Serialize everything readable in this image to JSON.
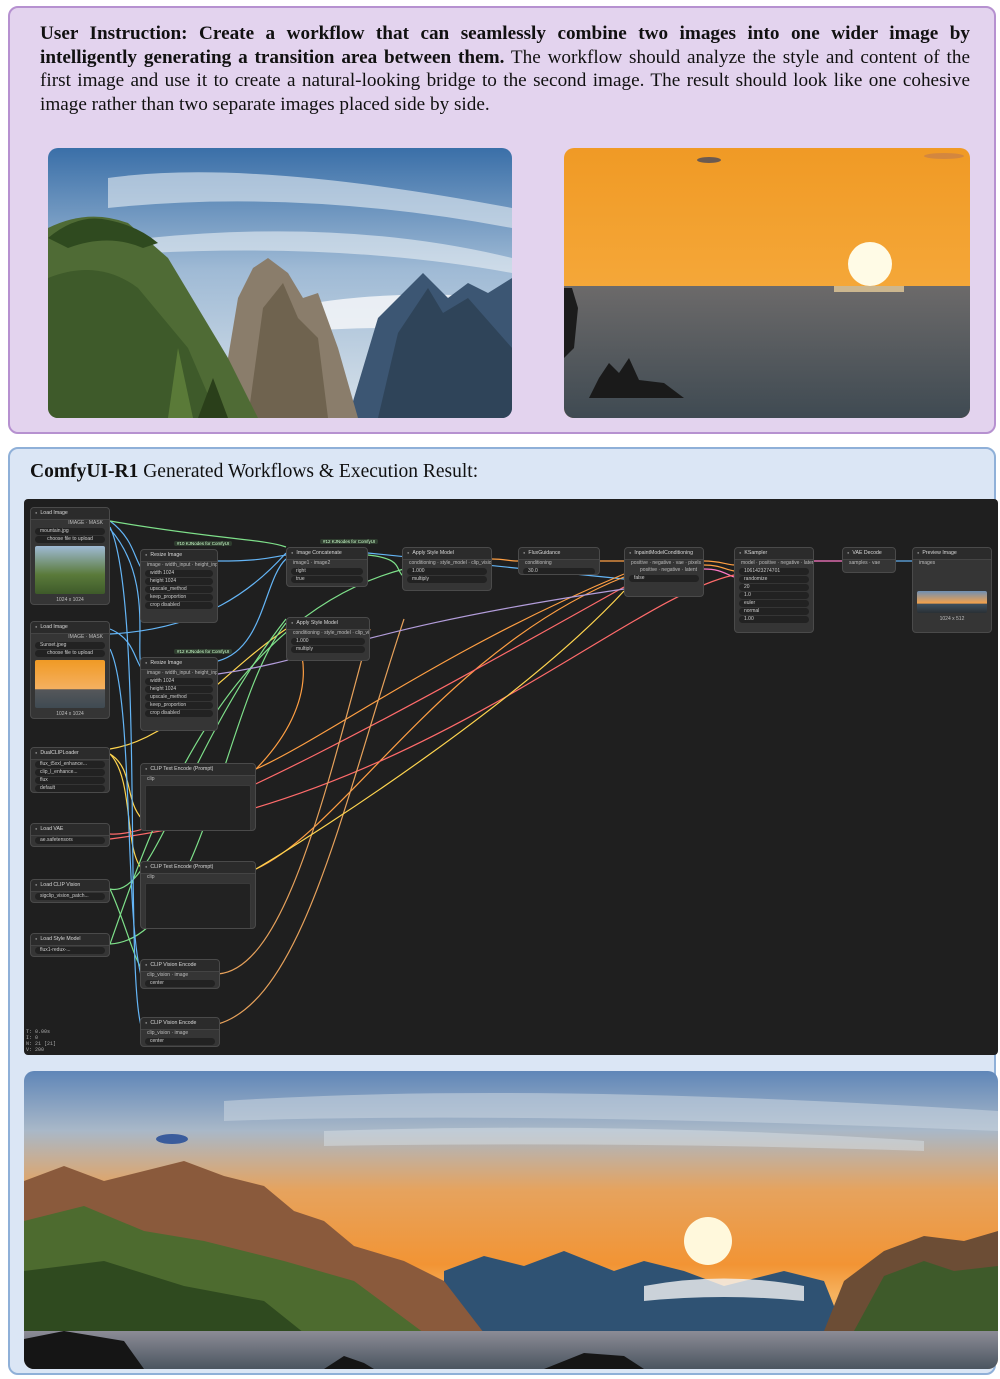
{
  "instruction": {
    "bold": "User Instruction: Create a workflow that can seamlessly combine two images into one wider image by intelligently generating a transition area between them.",
    "rest": " The workflow should analyze the style and content of the first image and use it to create a natural-looking bridge to the second image. The result should look like one cohesive image rather than two separate images placed side by side."
  },
  "result_title": {
    "bold": "ComfyUI-R1",
    "rest": " Generated Workflows & Execution Result:"
  },
  "nodes": {
    "load1": {
      "title": "Load Image",
      "id": "#1",
      "image": "mountain.jpg",
      "upload": "choose file to upload",
      "size": "1024 x 1024"
    },
    "load2": {
      "title": "Load Image",
      "id": "#2",
      "image": "Sunset.jpeg",
      "upload": "choose file to upload",
      "size": "1024 x 1024"
    },
    "resize1": {
      "title": "Resize Image",
      "badge": "#10 KJNodes for ComfyUI"
    },
    "resize2": {
      "title": "Resize Image",
      "badge": "#12 KJNodes for ComfyUI"
    },
    "dualclip": {
      "title": "DualCLIPLoader",
      "id": "#4",
      "w1": "flux_t5xxl_enhance...",
      "w2": "clip_l_enhance...",
      "w3": "flux",
      "w4": "default"
    },
    "vae": {
      "title": "Load VAE",
      "id": "#5",
      "w1": "ae.safetensors"
    },
    "clipvision": {
      "title": "Load CLIP Vision",
      "id": "#6",
      "w1": "sigclip_vision_patch..."
    },
    "stylemodel": {
      "title": "Load Style Model",
      "id": "#7",
      "w1": "flux1-redux-..."
    },
    "concat": {
      "title": "Image Concatenate",
      "badge": "#12 KJNodes for ComfyUI",
      "direction": "right",
      "match": "true"
    },
    "applystyle1": {
      "title": "Apply Style Model",
      "id": "#15",
      "strength": "1.000",
      "type": "multiply"
    },
    "applystyle2": {
      "title": "Apply Style Model",
      "id": "#13",
      "strength": "1.000",
      "type": "multiply"
    },
    "fluxguid": {
      "title": "FluxGuidance",
      "id": "#17",
      "guidance": "30.0"
    },
    "inpaint": {
      "title": "InpaintModelConditioning",
      "id": "#16",
      "noise": "false"
    },
    "ksampler": {
      "title": "KSampler",
      "id": "#9",
      "seed": "1061423274701",
      "control": "randomize",
      "steps": "20",
      "cfg": "1.0",
      "sampler": "euler",
      "scheduler": "normal",
      "denoise": "1.00"
    },
    "vaedecode": {
      "title": "VAE Decode",
      "id": "#20"
    },
    "preview": {
      "title": "Preview Image",
      "id": "#21",
      "size": "1024 x 512"
    },
    "clip1": {
      "title": "CLIP Text Encode (Prompt)",
      "id": "#8"
    },
    "clip2": {
      "title": "CLIP Text Encode (Prompt)",
      "id": "#3"
    },
    "cve1": {
      "title": "CLIP Vision Encode",
      "id": "#13",
      "crop": "center"
    },
    "cve2": {
      "title": "CLIP Vision Encode",
      "id": "#14",
      "crop": "center"
    }
  },
  "status": [
    "T: 0.00s",
    "I: 0",
    "N: 21 [21]",
    "V: 200"
  ]
}
